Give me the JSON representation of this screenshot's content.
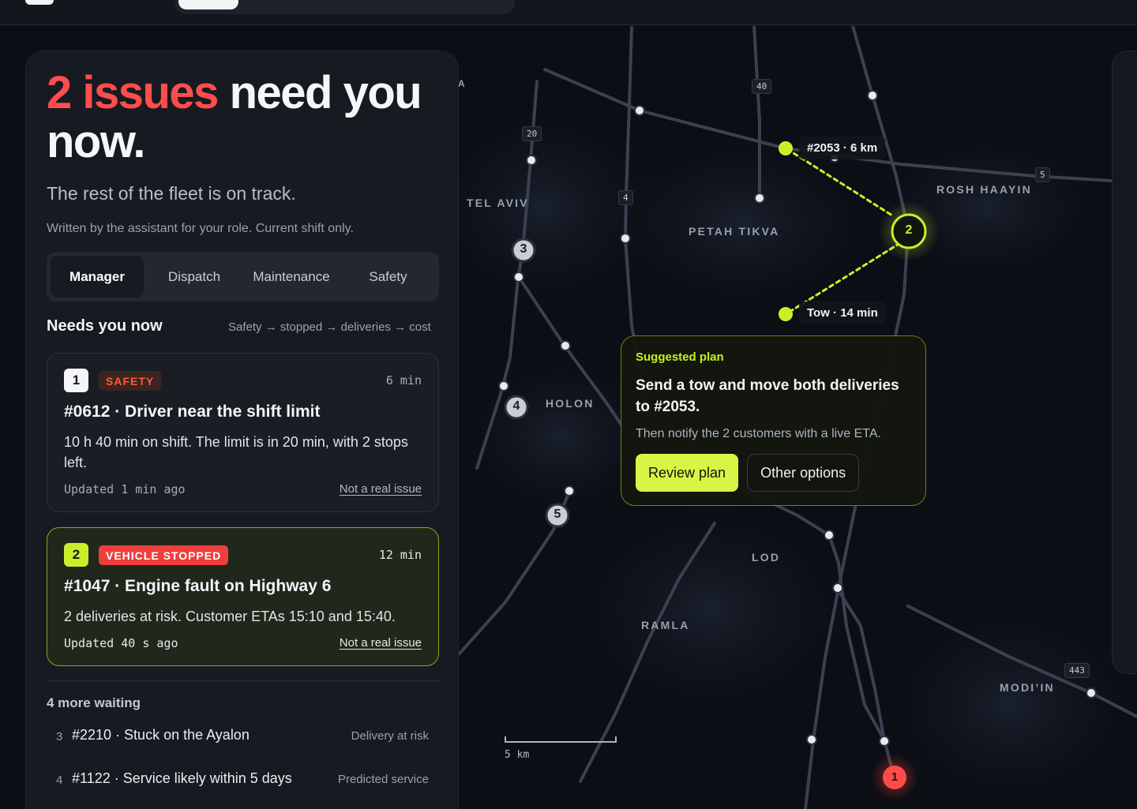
{
  "headline": {
    "count_text": "2 issues",
    "rest_text": "need you now.",
    "subtitle": "The rest of the fleet is on track.",
    "note": "Written by the assistant for your role. Current shift only."
  },
  "role_tabs": [
    {
      "label": "Manager",
      "active": true
    },
    {
      "label": "Dispatch",
      "active": false
    },
    {
      "label": "Maintenance",
      "active": false
    },
    {
      "label": "Safety",
      "active": false
    }
  ],
  "needs_section": {
    "title": "Needs you now",
    "order_hint": "Safety → stopped → deliveries → cost"
  },
  "issues": [
    {
      "number": "1",
      "tag": "SAFETY",
      "age": "6 min",
      "title": "#0612 · Driver near the shift limit",
      "body": "10 h 40 min on shift. The limit is in 20 min, with 2 stops left.",
      "updated": "Updated 1 min ago",
      "dismiss": "Not a real issue"
    },
    {
      "number": "2",
      "tag": "VEHICLE STOPPED",
      "age": "12 min",
      "title": "#1047 · Engine fault on Highway 6",
      "body": "2 deliveries at risk. Customer ETAs 15:10 and 15:40.",
      "updated": "Updated 40 s ago",
      "dismiss": "Not a real issue"
    }
  ],
  "more": {
    "title": "4 more waiting",
    "items": [
      {
        "number": "3",
        "title": "#2210 · Stuck on the Ayalon",
        "kind": "Delivery at risk"
      },
      {
        "number": "4",
        "title": "#1122 · Service likely within 5 days",
        "kind": "Predicted service"
      }
    ]
  },
  "map": {
    "cities": [
      "TEL AVIV",
      "PETAH TIKVA",
      "ROSH HAAYIN",
      "HOLON",
      "LOD",
      "RAMLA",
      "MODI’IN"
    ],
    "road_badges": [
      "20",
      "40",
      "4",
      "5",
      "443"
    ],
    "markers": [
      "3",
      "4",
      "5",
      "2",
      "1"
    ],
    "pin_labels": {
      "vehicle": "#2053 · 6 km",
      "tow": "Tow · 14 min"
    },
    "scale": "5 km",
    "partial_label": "A"
  },
  "plan": {
    "kicker": "Suggested plan",
    "title": "Send a tow and move both deliveries to #2053.",
    "subtitle": "Then notify the 2 customers with a live ETA.",
    "primary": "Review plan",
    "secondary": "Other options"
  },
  "colors": {
    "accent_lime": "#c8f02a",
    "alert_red": "#ef3e3e",
    "background": "#0d1017"
  }
}
